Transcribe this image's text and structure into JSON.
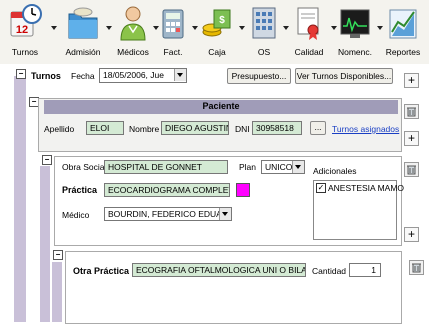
{
  "toolbar": {
    "items": [
      {
        "label": "Turnos"
      },
      {
        "label": "Admisión"
      },
      {
        "label": "Médicos"
      },
      {
        "label": "Fact."
      },
      {
        "label": "Caja"
      },
      {
        "label": "OS"
      },
      {
        "label": "Calidad"
      },
      {
        "label": "Nomenc."
      },
      {
        "label": "Reportes"
      }
    ]
  },
  "turnos": {
    "title": "Turnos",
    "fecha_label": "Fecha",
    "fecha_value": "18/05/2006, Jue",
    "presupuesto_label": "Presupuesto...",
    "ver_turnos_label": "Ver Turnos Disponibles...",
    "add_label": "+"
  },
  "paciente": {
    "title": "Paciente",
    "apellido_label": "Apellido",
    "apellido_value": "ELOI",
    "nombre_label": "Nombre",
    "nombre_value": "DIEGO AGUSTIN",
    "dni_label": "DNI",
    "dni_value": "30958518",
    "dots_label": "...",
    "turnos_asignados_label": "Turnos asignados",
    "add_label": "+"
  },
  "practica": {
    "obra_social_label": "Obra Social",
    "obra_social_value": "HOSPITAL DE GONNET",
    "plan_label": "Plan",
    "plan_value": "UNICO",
    "adicionales_label": "Adicionales",
    "adicional_item": "ANESTESIA MAMO",
    "practica_label": "Práctica",
    "practica_value": "ECOCARDIOGRAMA COMPLETO",
    "medico_label": "Médico",
    "medico_value": "BOURDIN, FEDERICO EDUARDO",
    "add_label": "+",
    "color_swatch": "#ff00ff"
  },
  "otra_practica": {
    "label": "Otra Práctica",
    "value": "ECOGRAFIA OFTALMOLOGICA UNI O BILATERAL",
    "cantidad_label": "Cantidad",
    "cantidad_value": "1"
  },
  "colors": {
    "field_bg": "#d4ead4",
    "panel_accent": "#c9c0d8",
    "header_bar": "#a09cb8"
  }
}
